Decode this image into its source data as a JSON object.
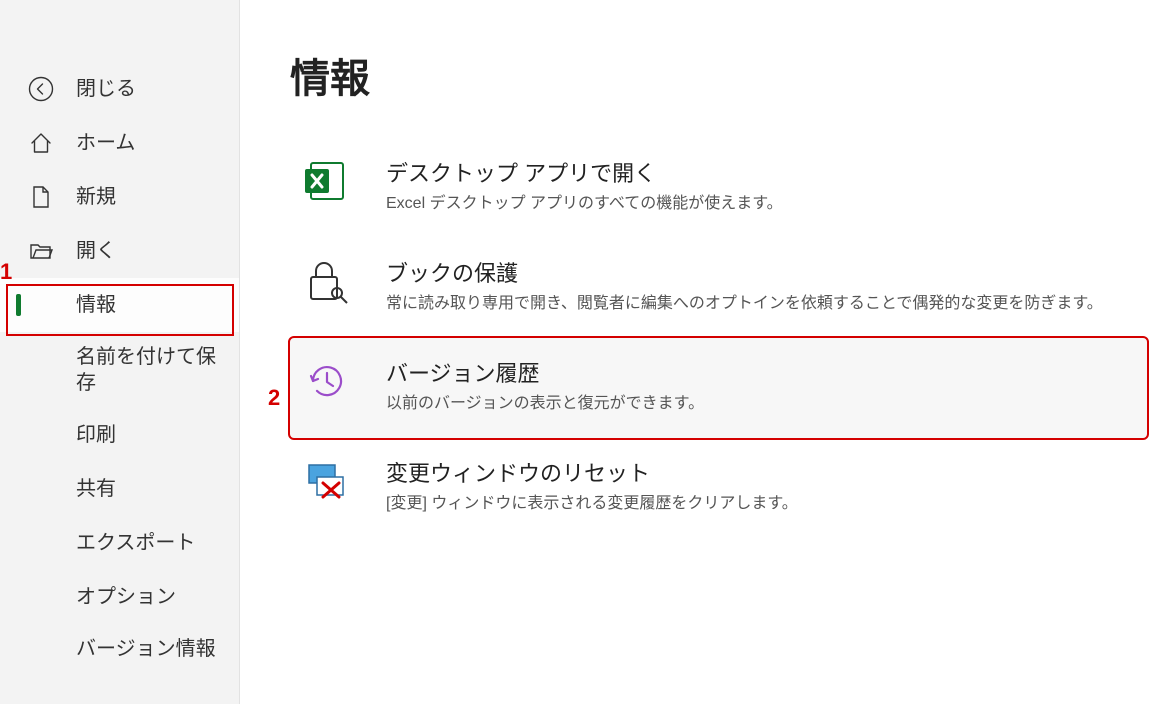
{
  "sidebar": {
    "items": [
      {
        "id": "close",
        "label": "閉じる",
        "icon": "back-arrow-circle"
      },
      {
        "id": "home",
        "label": "ホーム",
        "icon": "home"
      },
      {
        "id": "new",
        "label": "新規",
        "icon": "file"
      },
      {
        "id": "open",
        "label": "開く",
        "icon": "folder-open"
      },
      {
        "id": "info",
        "label": "情報",
        "icon": null,
        "selected": true
      },
      {
        "id": "saveas",
        "label": "名前を付けて保存",
        "icon": null,
        "multi": true
      },
      {
        "id": "print",
        "label": "印刷",
        "icon": null
      },
      {
        "id": "share",
        "label": "共有",
        "icon": null
      },
      {
        "id": "export",
        "label": "エクスポート",
        "icon": null
      },
      {
        "id": "options",
        "label": "オプション",
        "icon": null
      },
      {
        "id": "about",
        "label": "バージョン情報",
        "icon": null,
        "multi": true
      }
    ]
  },
  "main": {
    "title": "情報",
    "cards": [
      {
        "id": "open-desktop",
        "title": "デスクトップ アプリで開く",
        "desc": "Excel デスクトップ アプリのすべての機能が使えます。",
        "icon": "excel"
      },
      {
        "id": "protect",
        "title": "ブックの保護",
        "desc": "常に読み取り専用で開き、閲覧者に編集へのオプトインを依頼することで偶発的な変更を防ぎます。",
        "icon": "lock-key"
      },
      {
        "id": "version-history",
        "title": "バージョン履歴",
        "desc": "以前のバージョンの表示と復元ができます。",
        "icon": "history",
        "highlight": true
      },
      {
        "id": "reset-changes",
        "title": "変更ウィンドウのリセット",
        "desc": "[変更] ウィンドウに表示される変更履歴をクリアします。",
        "icon": "reset-changes"
      }
    ]
  },
  "annotations": {
    "label1": "1",
    "label2": "2"
  }
}
